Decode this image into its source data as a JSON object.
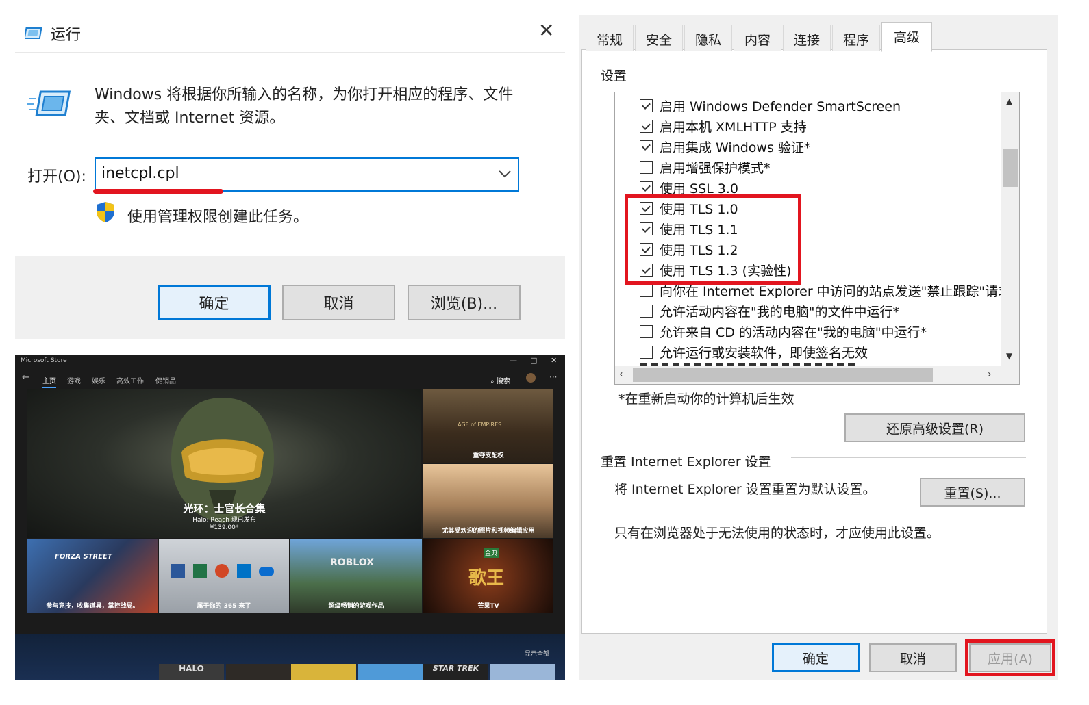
{
  "run": {
    "title": "运行",
    "close": "✕",
    "description": "Windows 将根据你所输入的名称，为你打开相应的程序、文件夹、文档或 Internet 资源。",
    "open_label": "打开(O):",
    "input_value": "inetcpl.cpl",
    "admin_note": "使用管理权限创建此任务。",
    "buttons": {
      "ok": "确定",
      "cancel": "取消",
      "browse": "浏览(B)..."
    }
  },
  "store": {
    "app_title": "Microsoft Store",
    "nav": [
      "主页",
      "游戏",
      "娱乐",
      "高效工作",
      "促销品"
    ],
    "search": "搜索",
    "hero_title": "光环：士官长合集",
    "hero_sub": "Halo: Reach 现已发布",
    "hero_price": "¥139.00*",
    "side_tiles": [
      "重夺支配权",
      "尤其受欢迎的照片和视频编辑应用"
    ],
    "tiles": [
      "参与竞技，收集道具，掌控战局。",
      "属于你的 365 来了",
      "超级畅销的游戏作品",
      "芒果TV"
    ],
    "tile_logos": [
      "FORZA STREET",
      "ROBLOX",
      "AGE of EMPIRES",
      "歌王",
      "金典",
      "HALO",
      "STAR TREK"
    ],
    "show_all": "显示全部"
  },
  "io": {
    "tabs": [
      "常规",
      "安全",
      "隐私",
      "内容",
      "连接",
      "程序",
      "高级"
    ],
    "settings_label": "设置",
    "items": [
      {
        "label": "启用 Windows Defender SmartScreen",
        "checked": true
      },
      {
        "label": "启用本机 XMLHTTP 支持",
        "checked": true
      },
      {
        "label": "启用集成 Windows 验证*",
        "checked": true
      },
      {
        "label": "启用增强保护模式*",
        "checked": false
      },
      {
        "label": "使用 SSL 3.0",
        "checked": true
      },
      {
        "label": "使用 TLS 1.0",
        "checked": true
      },
      {
        "label": "使用 TLS 1.1",
        "checked": true
      },
      {
        "label": "使用 TLS 1.2",
        "checked": true
      },
      {
        "label": "使用 TLS 1.3 (实验性)",
        "checked": true
      },
      {
        "label": "向你在 Internet Explorer 中访问的站点发送\"禁止跟踪\"请求*",
        "checked": false
      },
      {
        "label": "允许活动内容在\"我的电脑\"的文件中运行*",
        "checked": false
      },
      {
        "label": "允许来自 CD 的活动内容在\"我的电脑\"中运行*",
        "checked": false
      },
      {
        "label": "允许运行或安装软件，即使签名无效",
        "checked": false
      }
    ],
    "restart_note": "*在重新启动你的计算机后生效",
    "restore_btn": "还原高级设置(R)",
    "reset_group": "重置 Internet Explorer 设置",
    "reset_desc": "将 Internet Explorer 设置重置为默认设置。",
    "reset_btn": "重置(S)...",
    "reset_warn": "只有在浏览器处于无法使用的状态时，才应使用此设置。",
    "buttons": {
      "ok": "确定",
      "cancel": "取消",
      "apply": "应用(A)"
    }
  }
}
